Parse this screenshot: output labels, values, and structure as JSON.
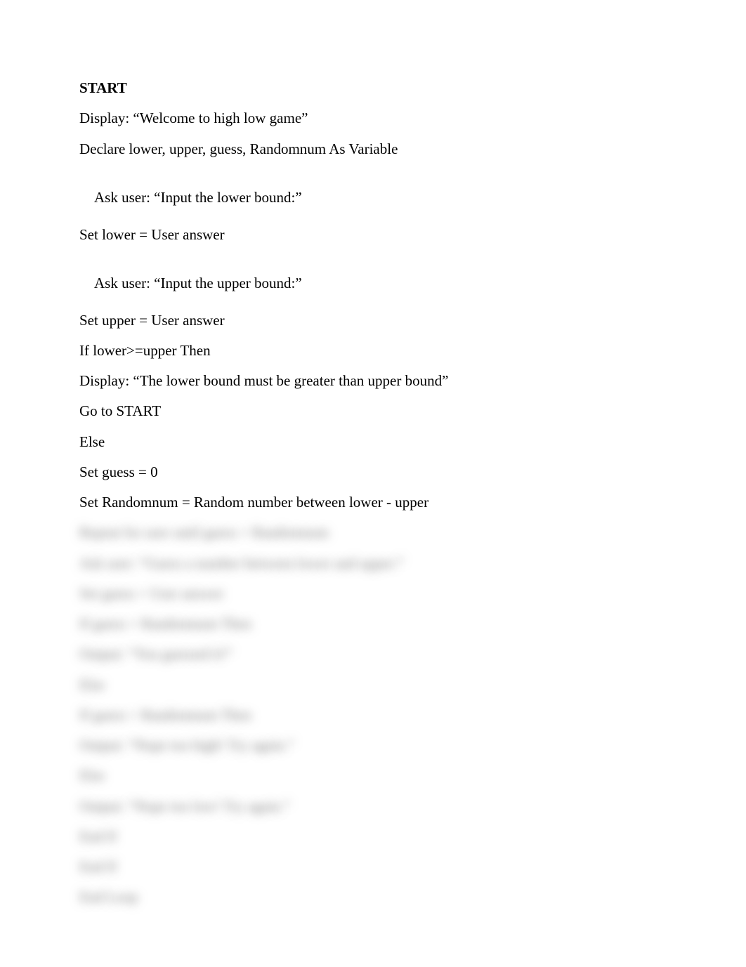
{
  "lines": {
    "l0": "START",
    "l1": "Display: “Welcome to high low game”",
    "l2": "Declare lower, upper, guess, Randomnum As Variable",
    "l3a": "Ask user: “Input the ",
    "l3b": "lower bound",
    "l3c": ":”",
    "l4": "Set lower = User answer",
    "l5a": "Ask user: “Input the ",
    "l5b": "upper bound",
    "l5c": ":”",
    "l6": "Set upper = User answer",
    "l7": "If lower>=upper Then",
    "l8": "Display: “The lower bound must be greater than upper bound”",
    "l9": "Go to START",
    "l10": "Else",
    "l11": "Set guess = 0",
    "l12": "Set Randomnum = Random number between lower - upper",
    "b1": "Repeat for user until guess = Randomnum",
    "b2": "Ask user: “Guess a number between lower and upper:”",
    "b3": "Set guess = User answer",
    "b4": "If guess = Randomnum Then",
    "b5": "Output: “You guessed it!”",
    "b6": "Else",
    "b7": "If guess > Randomnum Then",
    "b8": "Output: “Nope too high! Try again.”",
    "b9": "Else",
    "b10": "Output: “Nope too low! Try again.”",
    "b11": "End If",
    "b12": "End If",
    "b13": "End Loop"
  }
}
